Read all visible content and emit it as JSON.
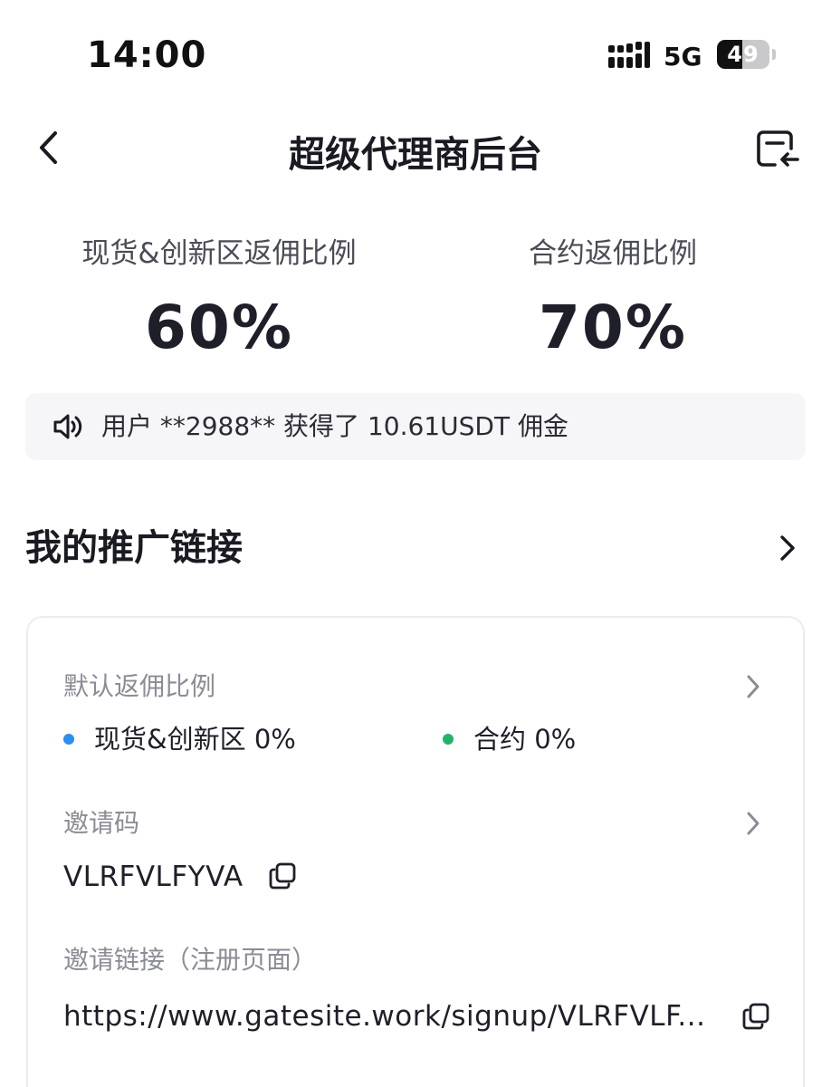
{
  "status_bar": {
    "time": "14:00",
    "network": "5G",
    "battery": "49",
    "battery_level_percent": 49
  },
  "nav": {
    "title": "超级代理商后台",
    "back_icon": "chevron-left-icon",
    "switch_icon": "switch-account-icon"
  },
  "rates": {
    "spot": {
      "label": "现货&创新区返佣比例",
      "value": "60%"
    },
    "contract": {
      "label": "合约返佣比例",
      "value": "70%"
    }
  },
  "notice": {
    "icon": "speaker-icon",
    "text": "用户 **2988** 获得了 10.61USDT 佣金"
  },
  "promo": {
    "title": "我的推广链接",
    "default_rate": {
      "label": "默认返佣比例",
      "spot": "现货&创新区 0%",
      "contract": "合约 0%"
    },
    "invite_code": {
      "label": "邀请码",
      "value": "VLRFVLFYVA"
    },
    "invite_link": {
      "label": "邀请链接（注册页面）",
      "value": "https://www.gatesite.work/signup/VLRFVLF..."
    }
  },
  "colors": {
    "spot_dot": "#2b8ef0",
    "contract_dot": "#24b36b",
    "muted_text": "#8b8c96"
  }
}
